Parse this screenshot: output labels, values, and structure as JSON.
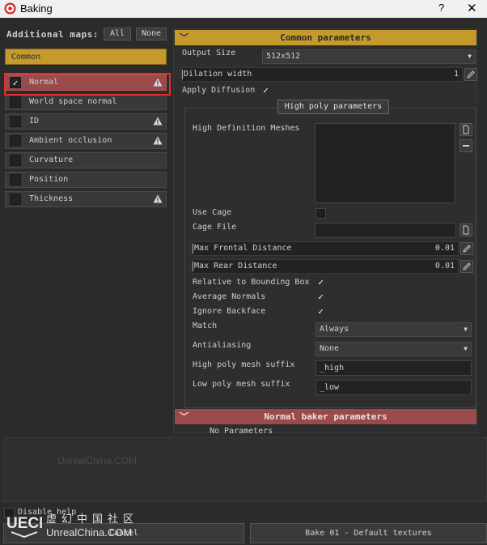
{
  "window": {
    "title": "Baking",
    "help_label": "?",
    "close_label": "✕",
    "accent": "#c49a2a",
    "danger": "#9a4a4a"
  },
  "left": {
    "additional_maps_label": "Additional maps:",
    "all_label": "All",
    "none_label": "None",
    "common_label": "Common",
    "maps": [
      {
        "label": "Normal",
        "checked": true,
        "warning": true
      },
      {
        "label": "World space normal",
        "checked": false,
        "warning": false
      },
      {
        "label": "ID",
        "checked": false,
        "warning": true
      },
      {
        "label": "Ambient occlusion",
        "checked": false,
        "warning": true
      },
      {
        "label": "Curvature",
        "checked": false,
        "warning": false
      },
      {
        "label": "Position",
        "checked": false,
        "warning": false
      },
      {
        "label": "Thickness",
        "checked": false,
        "warning": true
      }
    ]
  },
  "common": {
    "header": "Common parameters",
    "output_size_label": "Output Size",
    "output_size_value": "512x512",
    "dilation_label": "Dilation width",
    "dilation_value": "1",
    "apply_diffusion_label": "Apply Diffusion",
    "apply_diffusion_checked": true
  },
  "highpoly": {
    "tab_label": "High poly parameters",
    "meshes_label": "High Definition Meshes",
    "use_cage_label": "Use Cage",
    "use_cage_checked": false,
    "cage_file_label": "Cage File",
    "cage_file_value": "",
    "max_frontal_label": "Max Frontal Distance",
    "max_frontal_value": "0.01",
    "max_rear_label": "Max Rear Distance",
    "max_rear_value": "0.01",
    "relative_bbox_label": "Relative to Bounding Box",
    "relative_bbox_checked": true,
    "avg_normals_label": "Average Normals",
    "avg_normals_checked": true,
    "ignore_backface_label": "Ignore Backface",
    "ignore_backface_checked": true,
    "match_label": "Match",
    "match_value": "Always",
    "antialiasing_label": "Antialiasing",
    "antialiasing_value": "None",
    "high_suffix_label": "High poly mesh suffix",
    "high_suffix_value": "_high",
    "low_suffix_label": "Low poly mesh suffix",
    "low_suffix_value": "_low"
  },
  "normal_baker": {
    "header": "Normal baker parameters",
    "no_params_label": "No Parameters"
  },
  "bottom": {
    "disable_help_label": "Disable help",
    "cancel_label": "Cancel",
    "bake_label": "Bake 01 - Default textures"
  },
  "watermark": {
    "text": "UnrealChina.COM",
    "logo_cn": "虚幻中国社区",
    "logo_en": "UnrealChina.COM",
    "logo_mark": "UECN"
  }
}
